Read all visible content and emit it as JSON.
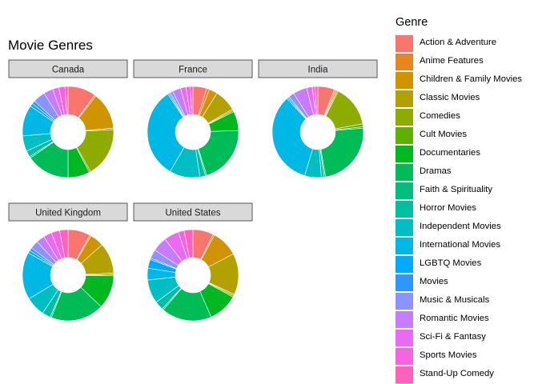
{
  "chart_data": {
    "type": "pie",
    "subtype": "donut facets",
    "title": "Movie Genres",
    "legend_title": "Genre",
    "legend_position": "right",
    "genres": [
      {
        "name": "Action & Adventure",
        "color": "#F8766D"
      },
      {
        "name": "Anime Features",
        "color": "#E7851E"
      },
      {
        "name": "Children & Family Movies",
        "color": "#D09400"
      },
      {
        "name": "Classic Movies",
        "color": "#B2A100"
      },
      {
        "name": "Comedies",
        "color": "#8EAB00"
      },
      {
        "name": "Cult Movies",
        "color": "#5BB300"
      },
      {
        "name": "Documentaries",
        "color": "#00B81F"
      },
      {
        "name": "Dramas",
        "color": "#00BC56"
      },
      {
        "name": "Faith & Spirituality",
        "color": "#00BF7D"
      },
      {
        "name": "Horror Movies",
        "color": "#00C0A1"
      },
      {
        "name": "Independent Movies",
        "color": "#00BFC4"
      },
      {
        "name": "International Movies",
        "color": "#00B8E5"
      },
      {
        "name": "LGBTQ Movies",
        "color": "#00ABFD"
      },
      {
        "name": "Movies",
        "color": "#2E96FF"
      },
      {
        "name": "Music & Musicals",
        "color": "#8B93FF"
      },
      {
        "name": "Romantic Movies",
        "color": "#C77CFF"
      },
      {
        "name": "Sci-Fi & Fantasy",
        "color": "#E76BF3"
      },
      {
        "name": "Sports Movies",
        "color": "#F863DF"
      },
      {
        "name": "Stand-Up Comedy",
        "color": "#FF62BC"
      }
    ],
    "facets": [
      {
        "name": "Canada",
        "values": [
          9,
          0.5,
          12,
          0.5,
          16,
          0.5,
          7,
          14,
          0.5,
          2,
          5,
          10,
          1,
          1,
          4,
          3,
          2,
          2,
          1
        ]
      },
      {
        "name": "France",
        "values": [
          5,
          1,
          3,
          8,
          0.5,
          0.5,
          7,
          21,
          0.5,
          2,
          11,
          33,
          0.5,
          0.5,
          1,
          3,
          2,
          1.5,
          1
        ]
      },
      {
        "name": "India",
        "values": [
          6,
          0.5,
          0.5,
          0.5,
          15,
          1,
          0.5,
          24,
          0.5,
          1,
          6,
          34,
          0.5,
          0.5,
          2,
          5,
          2,
          1,
          1
        ]
      },
      {
        "name": "United Kingdom",
        "values": [
          8,
          0.5,
          5,
          11,
          0.5,
          0.5,
          12,
          19,
          0.5,
          3,
          7,
          17,
          1,
          1,
          3,
          3,
          3,
          3,
          3
        ]
      },
      {
        "name": "United States",
        "values": [
          7,
          0.5,
          9,
          14,
          0.5,
          0.5,
          10,
          17,
          0.5,
          3,
          8,
          4,
          3,
          0.5,
          3,
          5,
          5,
          2,
          3
        ]
      }
    ]
  }
}
